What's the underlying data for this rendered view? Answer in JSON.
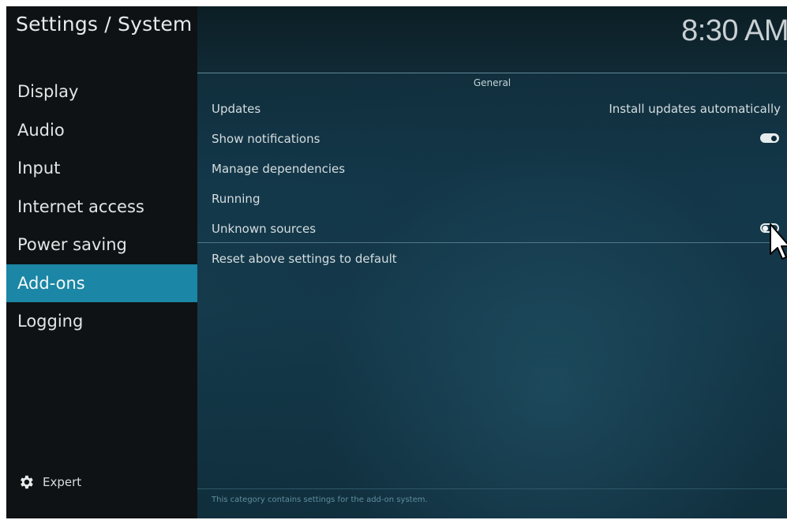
{
  "header": {
    "title": "Settings / System",
    "clock": "8:30 AM"
  },
  "sidebar": {
    "items": [
      {
        "label": "Display",
        "active": false
      },
      {
        "label": "Audio",
        "active": false
      },
      {
        "label": "Input",
        "active": false
      },
      {
        "label": "Internet access",
        "active": false
      },
      {
        "label": "Power saving",
        "active": false
      },
      {
        "label": "Add-ons",
        "active": true
      },
      {
        "label": "Logging",
        "active": false
      }
    ],
    "expert_label": "Expert",
    "expert_icon": "gear-icon"
  },
  "main": {
    "section_title": "General",
    "settings": [
      {
        "label": "Updates",
        "value": "Install updates automatically"
      },
      {
        "label": "Show notifications",
        "toggle": "on"
      },
      {
        "label": "Manage dependencies"
      },
      {
        "label": "Running"
      },
      {
        "label": "Unknown sources",
        "toggle": "off"
      },
      {
        "label": "Reset above settings to default"
      }
    ],
    "footer_text": "This category contains settings for the add-on system."
  },
  "colors": {
    "accent": "#1b86a5",
    "sidebar_bg": "#0e1214",
    "main_bg": "#13384a"
  }
}
